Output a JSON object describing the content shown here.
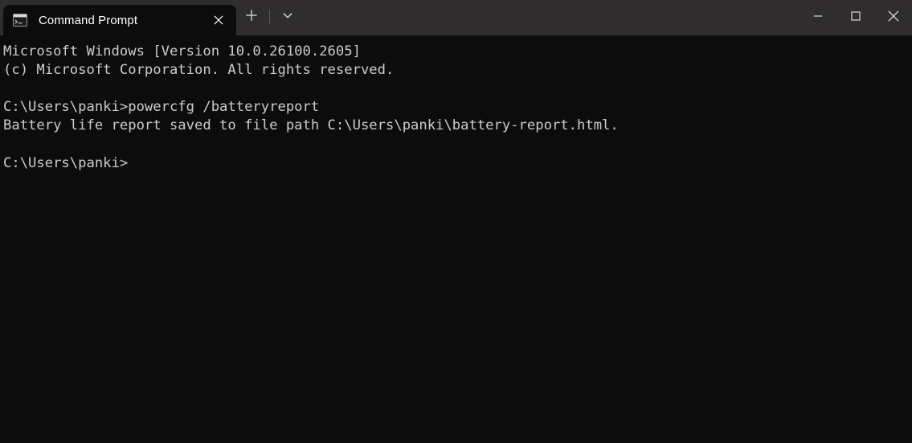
{
  "window": {
    "app": "Windows Terminal",
    "background_color": "#0c0c0c",
    "titlebar_color": "#2f2d2d",
    "text_color": "#cccccc"
  },
  "titlebar": {
    "tabs": [
      {
        "label": "Command Prompt",
        "icon": "console-icon",
        "active": true,
        "close_label": "✕"
      }
    ],
    "new_tab_label": "+",
    "dropdown_label": "⌄",
    "caption": {
      "minimize_label": "—",
      "maximize_label": "□",
      "close_label": "✕"
    }
  },
  "console": {
    "lines": [
      "Microsoft Windows [Version 10.0.26100.2605]",
      "(c) Microsoft Corporation. All rights reserved.",
      "",
      "C:\\Users\\panki>powercfg /batteryreport",
      "Battery life report saved to file path C:\\Users\\panki\\battery-report.html.",
      "",
      "C:\\Users\\panki>"
    ],
    "full_text": "Microsoft Windows [Version 10.0.26100.2605]\n(c) Microsoft Corporation. All rights reserved.\n\nC:\\Users\\panki>powercfg /batteryreport\nBattery life report saved to file path C:\\Users\\panki\\battery-report.html.\n\nC:\\Users\\panki>"
  }
}
